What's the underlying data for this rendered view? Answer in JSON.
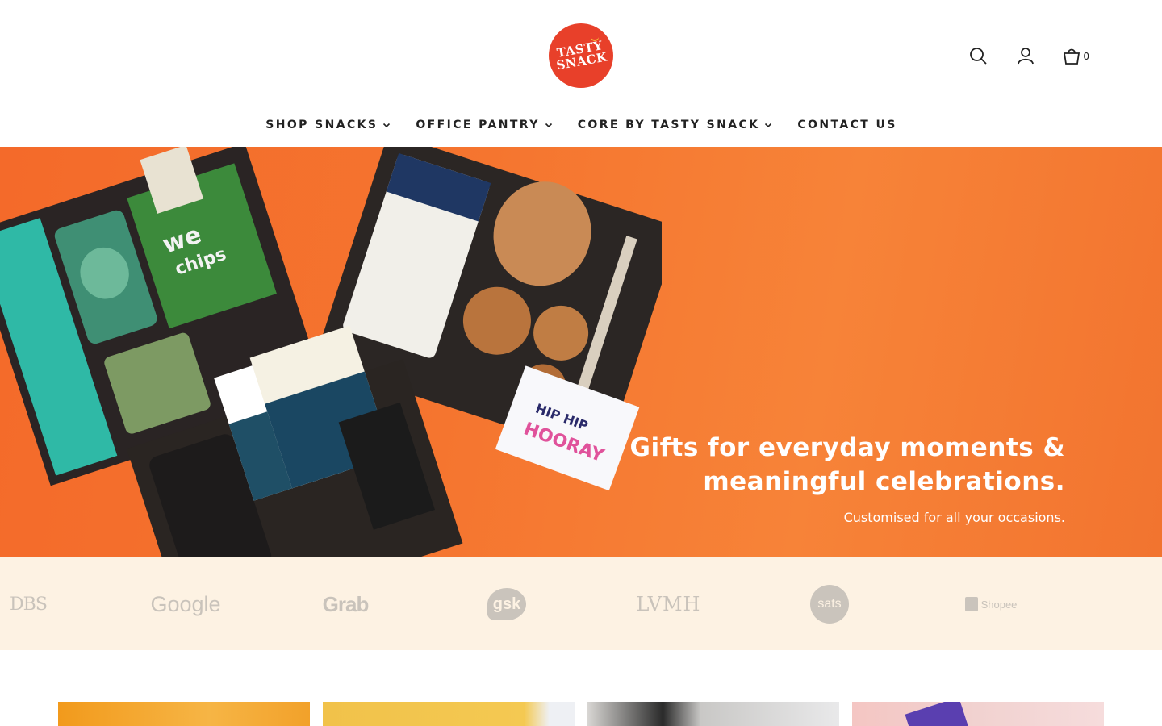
{
  "brand": {
    "logo_line1": "TASTY",
    "logo_line2": "SNACK",
    "logo_color": "#e8402a"
  },
  "header": {
    "icons": [
      "search-icon",
      "user-icon",
      "cart-icon"
    ],
    "cart_count": "0"
  },
  "nav": {
    "items": [
      {
        "label": "SHOP SNACKS",
        "has_dropdown": true
      },
      {
        "label": "OFFICE PANTRY",
        "has_dropdown": true
      },
      {
        "label": "CORE BY TASTY SNACK",
        "has_dropdown": true
      },
      {
        "label": "CONTACT US",
        "has_dropdown": false
      }
    ]
  },
  "hero": {
    "heading": "Gifts for everyday moments & meaningful celebrations.",
    "subheading": "Customised for all your occasions.",
    "background_color": "#f5752f"
  },
  "clients": {
    "logos": [
      "DBS",
      "Google",
      "Grab",
      "gsk",
      "LVMH",
      "sats",
      "Shopee"
    ],
    "background_color": "#fdf2e3"
  }
}
